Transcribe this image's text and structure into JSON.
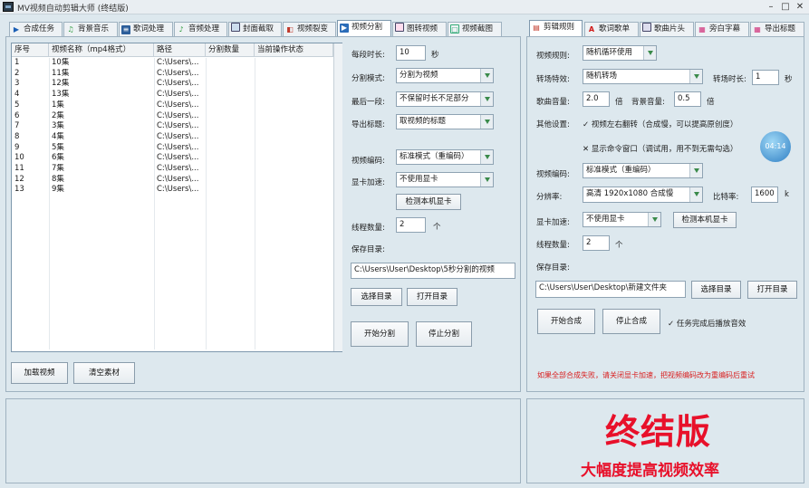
{
  "window": {
    "title": "MV视频自动剪辑大师 (终结版)",
    "min_glyph": "–",
    "max_glyph": "□",
    "close_glyph": "✕"
  },
  "left_tabs": [
    {
      "label": "合成任务",
      "icon": "play-icon"
    },
    {
      "label": "背景音乐",
      "icon": "music-icon"
    },
    {
      "label": "歌词处理",
      "icon": "lyrics-icon"
    },
    {
      "label": "音频处理",
      "icon": "audio-icon"
    },
    {
      "label": "封面截取",
      "icon": "image-icon"
    },
    {
      "label": "视频裂变",
      "icon": "split-icon"
    },
    {
      "label": "视频分割",
      "icon": "video-icon",
      "active": true
    },
    {
      "label": "图转视频",
      "icon": "picture-icon"
    },
    {
      "label": "视频截图",
      "icon": "screenshot-icon"
    }
  ],
  "right_tabs": [
    {
      "label": "剪辑规则",
      "icon": "rules-icon",
      "active": true
    },
    {
      "label": "歌词歌单",
      "icon": "font-icon"
    },
    {
      "label": "歌曲片头",
      "icon": "intro-icon"
    },
    {
      "label": "旁白字幕",
      "icon": "subtitle-icon"
    },
    {
      "label": "导出标题",
      "icon": "export-icon"
    }
  ],
  "table": {
    "headers": [
      "序号",
      "视频名称（mp4格式）",
      "路径",
      "分割数量",
      "当前操作状态"
    ],
    "rows": [
      {
        "no": "1",
        "name": "10集",
        "path": "C:\\Users\\..."
      },
      {
        "no": "2",
        "name": "11集",
        "path": "C:\\Users\\..."
      },
      {
        "no": "3",
        "name": "12集",
        "path": "C:\\Users\\..."
      },
      {
        "no": "4",
        "name": "13集",
        "path": "C:\\Users\\..."
      },
      {
        "no": "5",
        "name": "1集",
        "path": "C:\\Users\\..."
      },
      {
        "no": "6",
        "name": "2集",
        "path": "C:\\Users\\..."
      },
      {
        "no": "7",
        "name": "3集",
        "path": "C:\\Users\\..."
      },
      {
        "no": "8",
        "name": "4集",
        "path": "C:\\Users\\..."
      },
      {
        "no": "9",
        "name": "5集",
        "path": "C:\\Users\\..."
      },
      {
        "no": "10",
        "name": "6集",
        "path": "C:\\Users\\..."
      },
      {
        "no": "11",
        "name": "7集",
        "path": "C:\\Users\\..."
      },
      {
        "no": "12",
        "name": "8集",
        "path": "C:\\Users\\..."
      },
      {
        "no": "13",
        "name": "9集",
        "path": "C:\\Users\\..."
      }
    ]
  },
  "left_buttons": {
    "add": "加载视频",
    "clear": "清空素材"
  },
  "split": {
    "seg_len_label": "每段时长:",
    "seg_len_value": "10",
    "seg_len_unit": "秒",
    "mode_label": "分割模式:",
    "mode_value": "分割为视频",
    "last_label": "最后一段:",
    "last_value": "不保留时长不足部分",
    "title_label": "导出标题:",
    "title_value": "取视频的标题",
    "encode_label": "视频编码:",
    "encode_value": "标准模式（重编码）",
    "gpu_label": "显卡加速:",
    "gpu_value": "不使用显卡",
    "detect_gpu": "检测本机显卡",
    "threads_label": "线程数量:",
    "threads_value": "2",
    "threads_unit": "个",
    "save_label": "保存目录:",
    "save_value": "C:\\Users\\User\\Desktop\\5秒分割的视频",
    "choose_dir": "选择目录",
    "open_dir": "打开目录",
    "start": "开始分割",
    "stop": "停止分割"
  },
  "rules": {
    "video_rule_label": "视频规则:",
    "video_rule_value": "随机循环使用",
    "transition_label": "转场特效:",
    "transition_value": "随机转场",
    "transition_time_label": "转场时长:",
    "transition_time_value": "1",
    "transition_time_unit": "秒",
    "song_vol_label": "歌曲音量:",
    "song_vol_value": "2.0",
    "song_vol_unit": "倍",
    "bg_vol_label": "背景音量:",
    "bg_vol_value": "0.5",
    "bg_vol_unit": "倍",
    "other_label": "其他设置:",
    "flip_option": "✓ 视频左右翻转（合成慢，可以提高原创度）",
    "cmd_option": "✕ 显示命令窗口（调试用，用不到无需勾选）",
    "encode_label": "视频编码:",
    "encode_value": "标准模式（重编码）",
    "resolution_label": "分辨率:",
    "resolution_value": "高清 1920x1080 合成慢",
    "bitrate_label": "比特率:",
    "bitrate_value": "1600",
    "bitrate_unit": "k",
    "gpu_label": "显卡加速:",
    "gpu_value": "不使用显卡",
    "detect_gpu": "检测本机显卡",
    "threads_label": "线程数量:",
    "threads_value": "2",
    "threads_unit": "个",
    "save_label": "保存目录:",
    "save_value": "C:\\Users\\User\\Desktop\\新建文件夹",
    "choose_dir": "选择目录",
    "open_dir": "打开目录",
    "start": "开始合成",
    "stop": "停止合成",
    "sound_option": "✓ 任务完成后播放音效",
    "warning": "如果全部合成失败，请关闭显卡加速，把视频编码改为重编码后重试"
  },
  "badge_text": "04:14",
  "promo": {
    "big": "终结版",
    "sub": "大幅度提高视频效率"
  }
}
